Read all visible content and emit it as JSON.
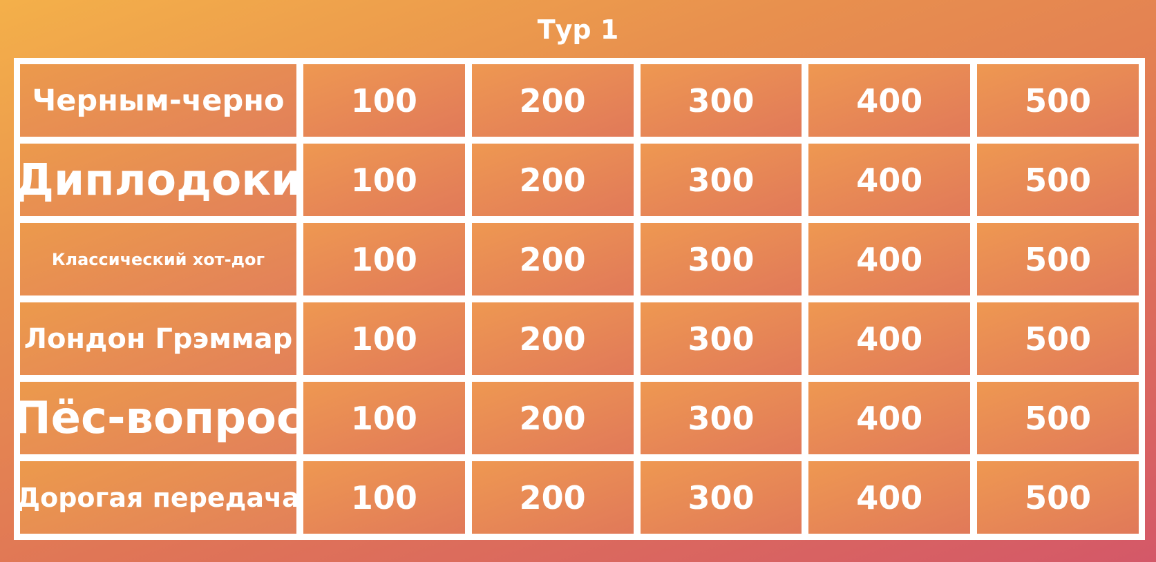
{
  "title": "Тур 1",
  "categories": [
    {
      "label": "Черным-черно"
    },
    {
      "label": "Диплодоки"
    },
    {
      "label": "Классический хот-дог"
    },
    {
      "label": "Лондон Грэммар"
    },
    {
      "label": "Пёс-вопрос"
    },
    {
      "label": "Дорогая передача"
    }
  ],
  "values": [
    "100",
    "200",
    "300",
    "400",
    "500"
  ]
}
